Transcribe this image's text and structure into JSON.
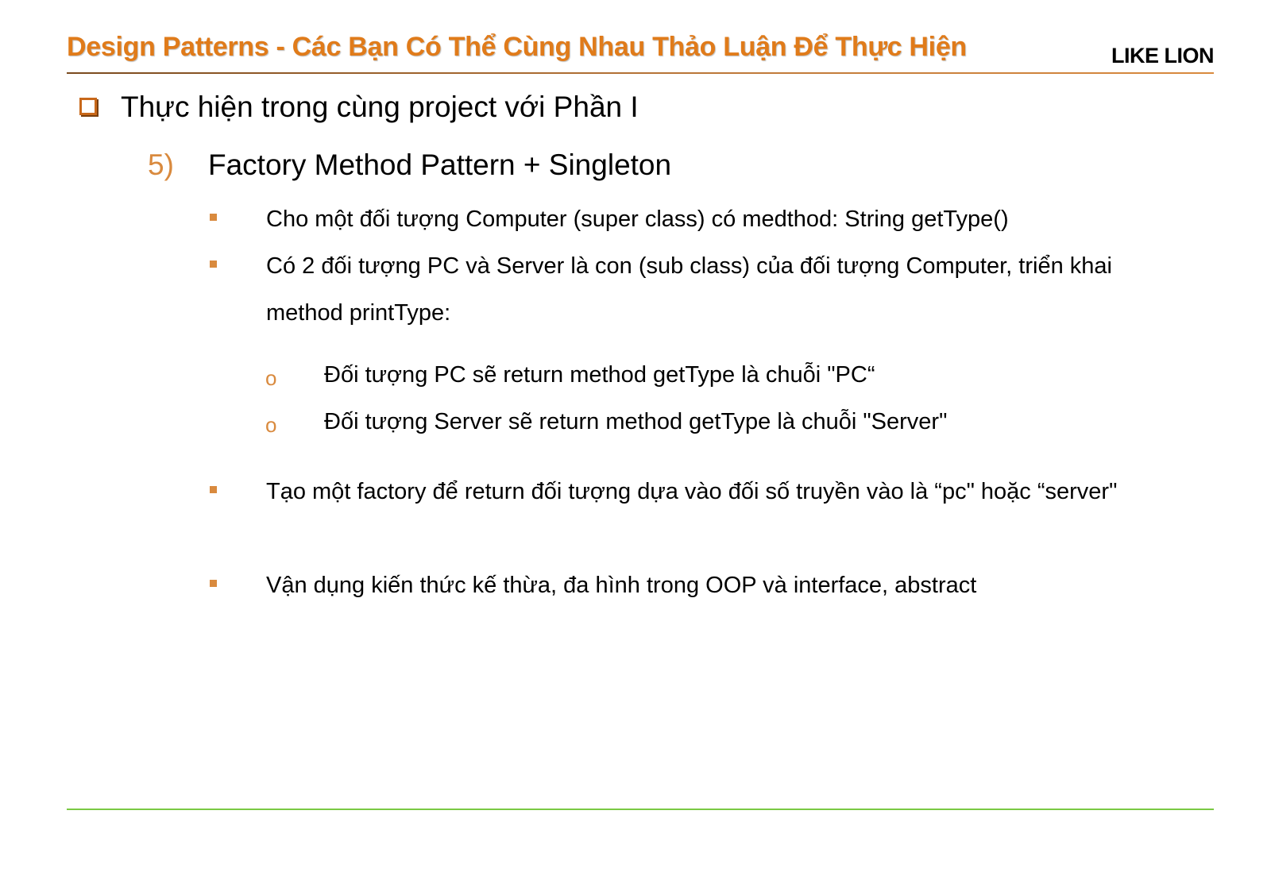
{
  "header": {
    "title": "Design Patterns - Các Bạn Có Thể Cùng Nhau Thảo Luận Để Thực Hiện",
    "logo": "LIKE LION"
  },
  "content": {
    "level1": "Thực hiện trong cùng project với Phần I",
    "section_number": "5)",
    "section_title": "Factory Method Pattern + Singleton",
    "bullets": [
      "Cho một đối tượng Computer (super class) có medthod: String getType()",
      "Có 2 đối tượng PC và Server là con (sub class) của đối tượng Computer, triển khai method printType:",
      "Tạo một factory để return đối tượng dựa vào đối số truyền vào là “pc\" hoặc “server\"",
      "Vận dụng kiến thức kế thừa, đa hình trong OOP và interface, abstract"
    ],
    "sub_bullets": [
      "Đối tượng PC sẽ return method getType là chuỗi \"PC“",
      "Đối tượng Server sẽ return method getType là chuỗi \"Server\""
    ]
  },
  "colors": {
    "title": "#e07b1a",
    "accent": "#d98a3e",
    "footer_rule": "#7ac943"
  },
  "icons": {
    "level1_bullet": "square-checkbox-icon",
    "level3_bullet": "small-square-icon",
    "level4_bullet": "hollow-circle-icon"
  }
}
